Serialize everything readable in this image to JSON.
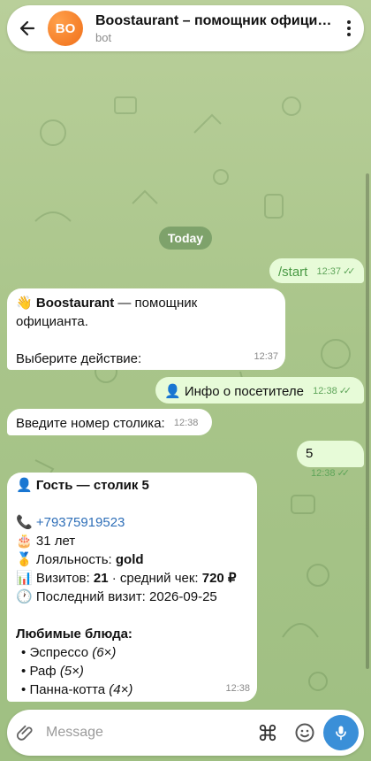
{
  "header": {
    "avatar_initials": "BO",
    "title": "Boostaurant – помощник официанта",
    "subtitle": "bot"
  },
  "date_divider": "Today",
  "messages": {
    "m1": {
      "text": "/start",
      "time": "12:37"
    },
    "m2": {
      "emoji": "👋",
      "bold": "Boostaurant",
      "line1_rest": " — помощник",
      "line2": "официанта.",
      "line3": "Выберите действие:",
      "time": "12:37"
    },
    "m3": {
      "emoji": "👤",
      "text": "Инфо о посетителе",
      "time": "12:38"
    },
    "m4": {
      "text": "Введите номер столика:",
      "time": "12:38"
    },
    "m5": {
      "text": "5",
      "time": "12:38"
    },
    "m6": {
      "emoji_guest": "👤",
      "guest_title": "Гость — столик 5",
      "emoji_phone": "📞",
      "phone": "+79375919523",
      "emoji_age": "🎂",
      "age": "31 лет",
      "emoji_loyalty": "🥇",
      "loyalty_label": "Лояльность: ",
      "loyalty_value": "gold",
      "emoji_visits": "📊",
      "visits_label": "Визитов: ",
      "visits_value": "21",
      "avg_label": " · средний чек: ",
      "avg_value": "720 ₽",
      "emoji_last": "🕐",
      "last_visit": "Последний визит: 2026-09-25",
      "favorites_title": "Любимые блюда:",
      "favorites": [
        {
          "bullet": "•",
          "name": "Эспрессо",
          "count": "(6×)"
        },
        {
          "bullet": "•",
          "name": "Раф",
          "count": "(5×)"
        },
        {
          "bullet": "•",
          "name": "Панна-котта",
          "count": "(4×)"
        }
      ],
      "time": "12:38"
    }
  },
  "composer": {
    "placeholder": "Message"
  },
  "icons": {
    "back": "arrow-left-icon",
    "menu": "more-vertical-icon",
    "attach": "paperclip-icon",
    "commands": "command-icon",
    "emoji": "smiley-icon",
    "mic": "microphone-icon"
  },
  "colors": {
    "chat_bg": "#a9c58a",
    "outgoing_bubble": "#e7fbd8",
    "incoming_bubble": "#ffffff",
    "avatar": "#f58a2e",
    "mic_button": "#3a8fd8",
    "link": "#2f6fb8",
    "read_ticks": "#5fa55a"
  }
}
